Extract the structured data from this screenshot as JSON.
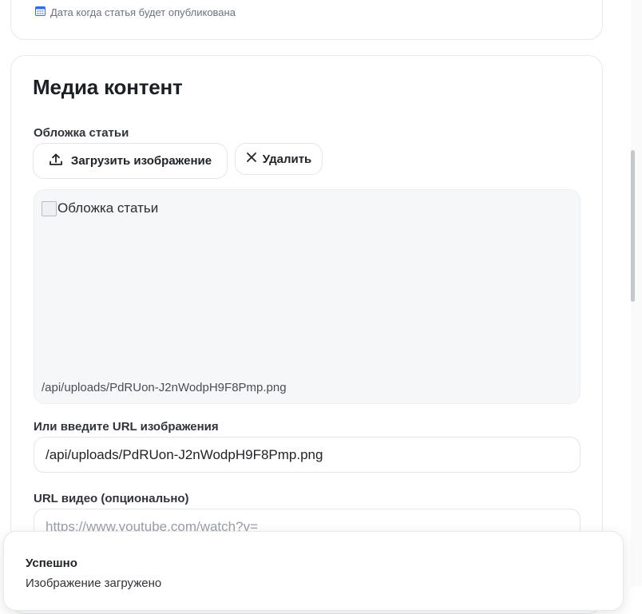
{
  "date_hint": {
    "text": "Дата когда статья будет опубликована",
    "icon": "calendar-icon"
  },
  "media": {
    "title": "Медиа контент",
    "cover_label": "Обложка статьи",
    "upload_button": "Загрузить изображение",
    "delete_button": "Удалить",
    "preview_alt": "Обложка статьи",
    "preview_path": "/api/uploads/PdRUon-J2nWodpH9F8Pmp.png",
    "url_label": "Или введите URL изображения",
    "url_value": "/api/uploads/PdRUon-J2nWodpH9F8Pmp.png",
    "video_label": "URL видео (опционально)",
    "video_placeholder": "https://www.youtube.com/watch?v="
  },
  "toast": {
    "title": "Успешно",
    "description": "Изображение загружено"
  },
  "colors": {
    "border": "#e3e5ea",
    "muted": "#6b7280",
    "preview_bg": "#f6f7f9",
    "calendar": "#2f6fe4"
  }
}
